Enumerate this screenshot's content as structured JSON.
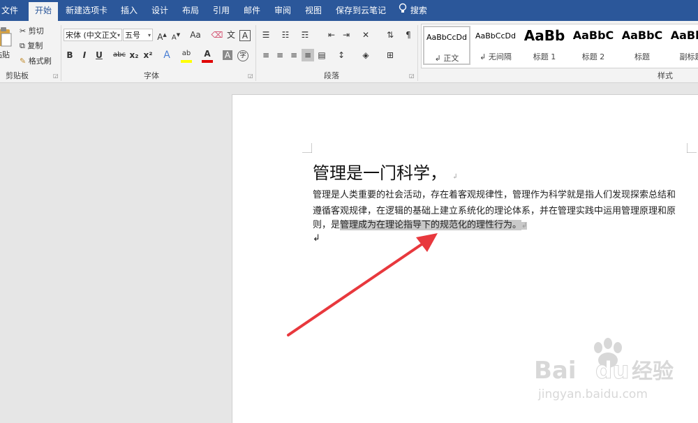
{
  "menu": {
    "tabs": [
      "文件",
      "开始",
      "新建选项卡",
      "插入",
      "设计",
      "布局",
      "引用",
      "邮件",
      "审阅",
      "视图",
      "保存到云笔记"
    ],
    "active_tab": "开始",
    "search_label": "搜索"
  },
  "ribbon": {
    "clipboard": {
      "paste_label": "粘贴",
      "cut_label": "剪切",
      "copy_label": "复制",
      "format_painter_label": "格式刷",
      "group_label": "剪贴板"
    },
    "font": {
      "font_name": "宋体 (中文正文",
      "font_size": "五号",
      "group_label": "字体",
      "grow_font_label": "A",
      "shrink_font_label": "A",
      "change_case_label": "Aa",
      "phonetic_label": "文",
      "char_border_label": "A",
      "bold_label": "B",
      "italic_label": "I",
      "underline_label": "U",
      "strikethrough_label": "abc",
      "subscript_label": "x₂",
      "superscript_label": "x²",
      "text_effects_label": "A",
      "highlight_label": "ab",
      "font_color_label": "A",
      "char_shading_label": "A",
      "enclose_label": "字",
      "highlight_color": "#ffff00",
      "font_color": "#e00000"
    },
    "paragraph": {
      "group_label": "段落"
    },
    "styles": {
      "group_label": "样式",
      "items": [
        {
          "sample": "AaBbCcDd",
          "name": "↲ 正文"
        },
        {
          "sample": "AaBbCcDd",
          "name": "↲ 无间隔"
        },
        {
          "sample": "AaBb",
          "name": "标题 1"
        },
        {
          "sample": "AaBbC",
          "name": "标题 2"
        },
        {
          "sample": "AaBbC",
          "name": "标题"
        },
        {
          "sample": "AaBbC",
          "name": "副标题"
        }
      ]
    }
  },
  "document": {
    "title": "管理是一门科学，",
    "paragraph_lines": [
      "管理是人类重要的社会活动，存在着客观规律性，管理作为科学就是指人们发现探索总结和",
      "遵循客观规律，在逻辑的基础上建立系统化的理论体系，并在管理实践中运用管理原理和原"
    ],
    "line3_plain": "则，是",
    "line3_selected": "管理成为在理论指导下的规范化的理性行为。",
    "paragraph_mark": "↲"
  },
  "annotation": {
    "arrow_color": "#e8383d"
  },
  "watermark": {
    "brand": "Bai du 经验",
    "url": "jingyan.baidu.com"
  }
}
